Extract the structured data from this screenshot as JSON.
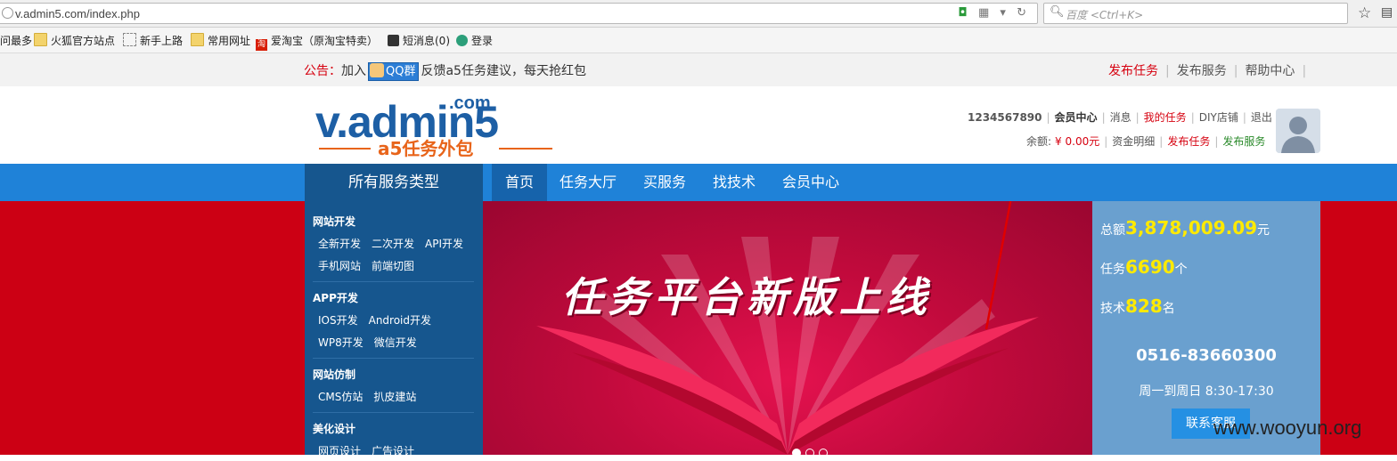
{
  "browser": {
    "url": "v.admin5.com/index.php",
    "search_placeholder": "百度 <Ctrl+K>",
    "bookmarks": [
      {
        "label": "问最多",
        "icon": "none"
      },
      {
        "label": "火狐官方站点",
        "icon": "folder-icon"
      },
      {
        "label": "新手上路",
        "icon": "page-icon"
      },
      {
        "label": "常用网址",
        "icon": "folder-icon"
      },
      {
        "label": "爱淘宝（原淘宝特卖）",
        "icon": "taobao-icon"
      },
      {
        "label": "短消息(0)",
        "icon": "bird-icon"
      },
      {
        "label": "登录",
        "icon": "login-icon"
      }
    ]
  },
  "notice": {
    "label": "公告：",
    "prefix": "加入",
    "qq_label": "QQ群",
    "suffix": "反馈a5任务建议，每天抢红包"
  },
  "top_links": [
    "发布任务",
    "发布服务",
    "帮助中心"
  ],
  "logo": {
    "main": "v.admin5",
    "com": ".com",
    "sub": "a5任务外包"
  },
  "user": {
    "id": "1234567890",
    "member_center": "会员中心",
    "messages": "消息",
    "my_tasks": "我的任务",
    "diy_shop": "DIY店铺",
    "logout": "退出",
    "balance_label": "余额:",
    "balance_value": "¥ 0.00元",
    "fund_details": "资金明细",
    "publish_task": "发布任务",
    "publish_service": "发布服务"
  },
  "nav": {
    "all_services": "所有服务类型",
    "items": [
      "首页",
      "任务大厅",
      "买服务",
      "找技术",
      "会员中心"
    ]
  },
  "categories": [
    {
      "title": "网站开发",
      "rows": [
        [
          "全新开发",
          "二次开发",
          "API开发"
        ],
        [
          "手机网站",
          "前端切图"
        ]
      ]
    },
    {
      "title": "APP开发",
      "rows": [
        [
          "IOS开发",
          "Android开发"
        ],
        [
          "WP8开发",
          "微信开发"
        ]
      ]
    },
    {
      "title": "网站仿制",
      "rows": [
        [
          "CMS仿站",
          "扒皮建站"
        ]
      ]
    },
    {
      "title": "美化设计",
      "rows": [
        [
          "网页设计",
          "广告设计"
        ]
      ]
    }
  ],
  "banner": {
    "title": "任务平台新版上线"
  },
  "stats": {
    "total_label": "总额",
    "total_value": "3,878,009.09",
    "total_unit": "元",
    "tasks_label": "任务",
    "tasks_value": "6690",
    "tasks_unit": "个",
    "tech_label": "技术",
    "tech_value": "828",
    "tech_unit": "名",
    "phone": "0516-83660300",
    "hours": "周一到周日 8:30-17:30",
    "contact_button": "联系客服"
  },
  "watermark": "www.wooyun.org",
  "colors": {
    "brand_blue": "#1f82d8",
    "dark_blue": "#16568e",
    "red": "#d6000f",
    "green": "#2a8a2a",
    "yellow": "#ffea00"
  }
}
